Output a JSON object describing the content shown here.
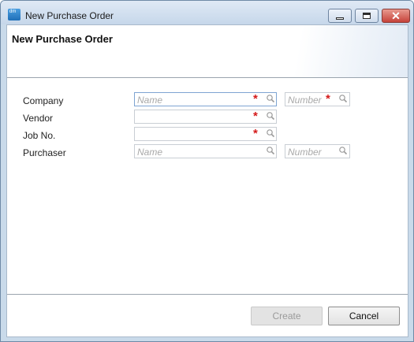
{
  "window": {
    "title": "New Purchase Order",
    "app_icon_text": "dm",
    "controls": {
      "minimize_icon": "minimize-icon",
      "maximize_icon": "maximize-icon",
      "close_icon": "close-icon",
      "close_glyph": "✕"
    }
  },
  "header": {
    "title": "New Purchase Order"
  },
  "form": {
    "company": {
      "label": "Company",
      "name_placeholder": "Name",
      "number_placeholder": "Number",
      "required_mark": "*"
    },
    "vendor": {
      "label": "Vendor",
      "required_mark": "*"
    },
    "job_no": {
      "label": "Job No.",
      "required_mark": "*"
    },
    "purchaser": {
      "label": "Purchaser",
      "name_placeholder": "Name",
      "number_placeholder": "Number"
    }
  },
  "buttons": {
    "create": "Create",
    "cancel": "Cancel"
  },
  "colors": {
    "required": "#d41a1a",
    "close_button": "#c6423a",
    "focus_border": "#7ea4d2"
  }
}
